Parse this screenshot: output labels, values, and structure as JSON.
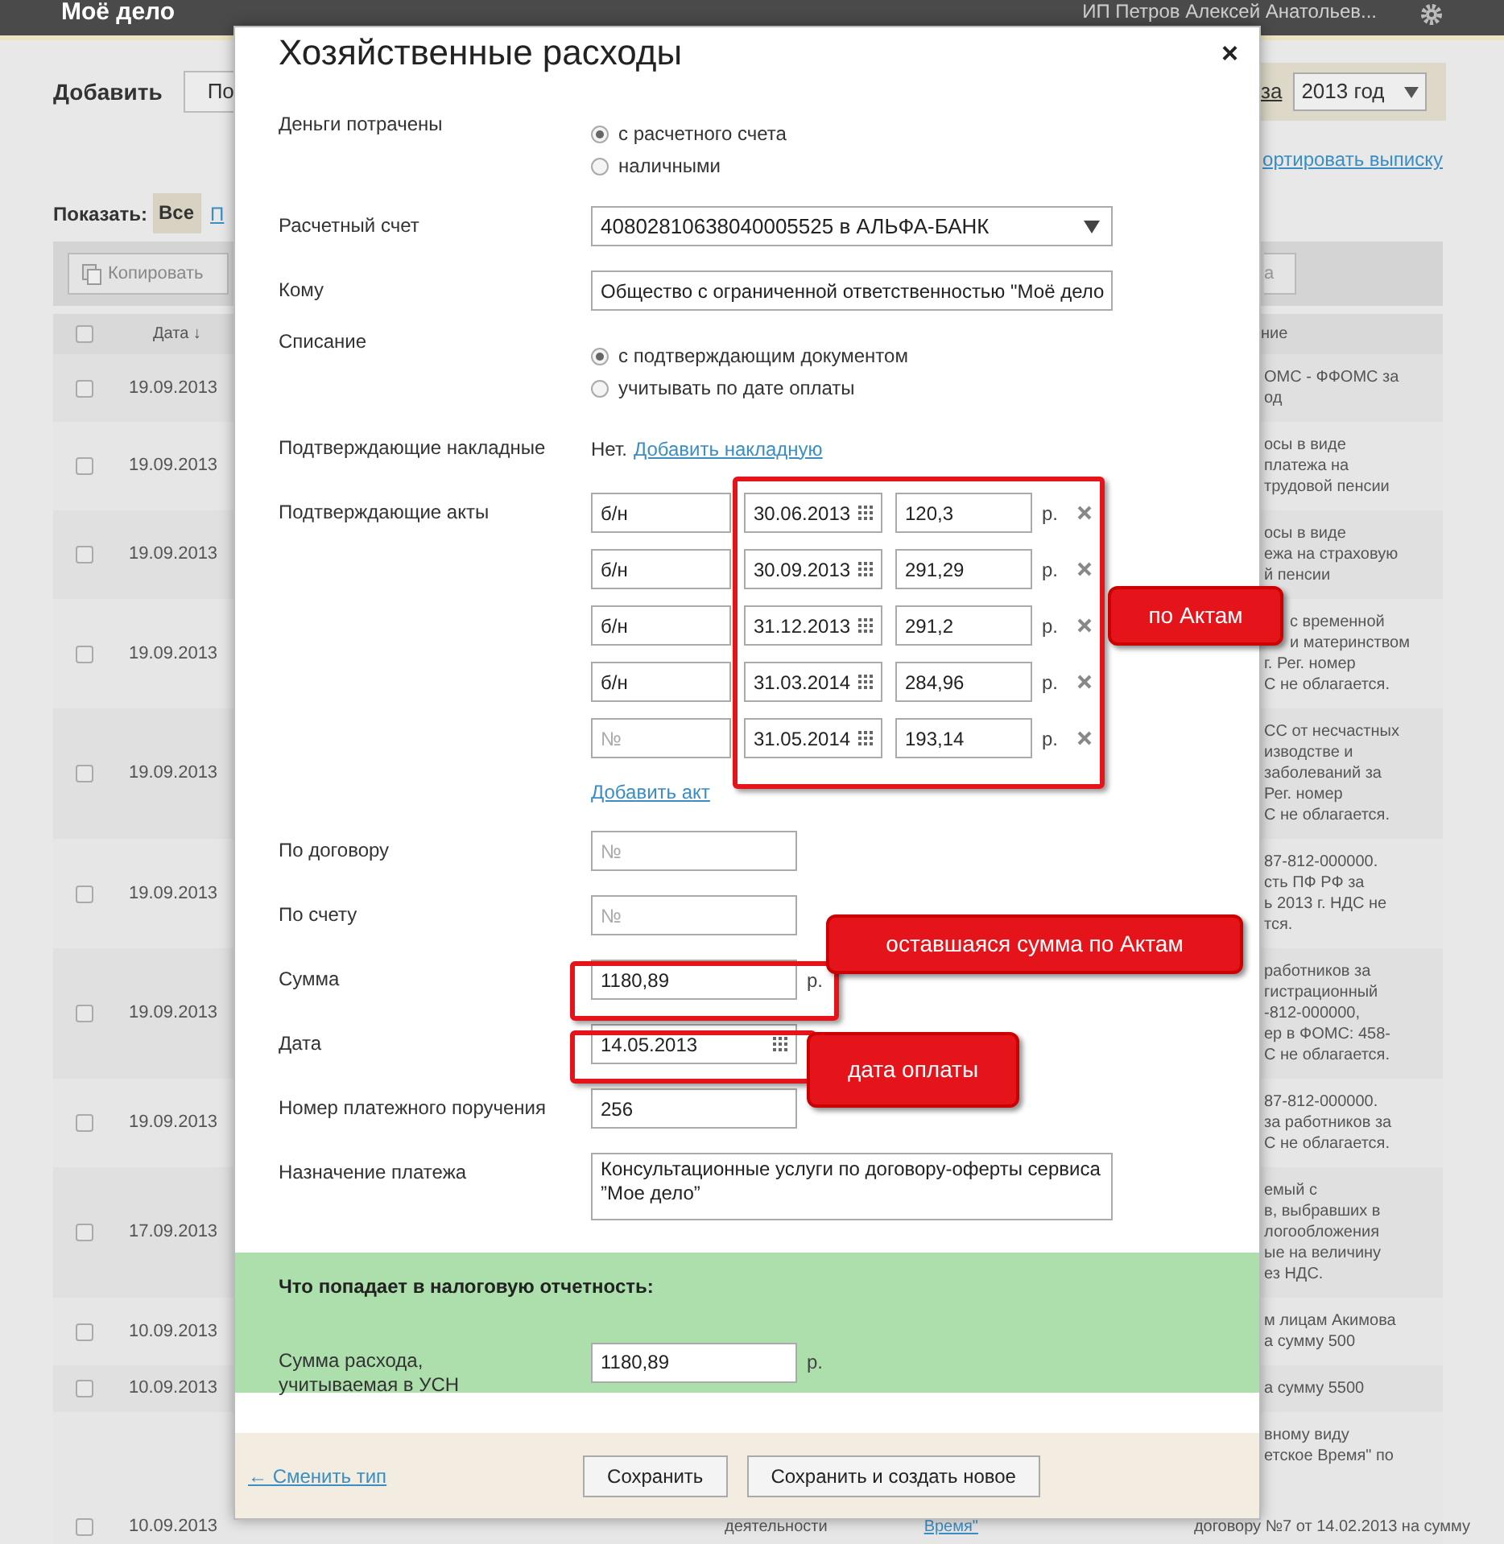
{
  "app": {
    "logo": "Моё дело",
    "user": "ИП Петров Алексей Анатольев..."
  },
  "page": {
    "add_label": "Добавить",
    "add_button": "По",
    "period_link": "за",
    "year_select": "2013 год",
    "import_link": "ортировать выписку",
    "show_label": "Показать:",
    "filters": [
      {
        "label": "Все",
        "selected": true
      },
      {
        "label": "П",
        "selected": false
      }
    ],
    "toolbar": {
      "copy_button": "Копировать",
      "right_button": "а"
    },
    "table": {
      "select_all": {
        "checked": false
      },
      "columns": [
        {
          "label": "Дата ↓"
        },
        {
          "label": "ние"
        }
      ],
      "rows": [
        {
          "checked": false,
          "date": "19.09.2013",
          "description": [
            "ОМС - ФФОМС за",
            "од"
          ]
        },
        {
          "checked": false,
          "date": "19.09.2013",
          "description": [
            "осы в виде",
            "платежа на",
            "трудовой пенсии"
          ]
        },
        {
          "checked": false,
          "date": "19.09.2013",
          "description": [
            "осы в виде",
            "ежа на страховую",
            "й пенсии"
          ]
        },
        {
          "checked": false,
          "date": "19.09.2013",
          "description": [
            "с временной",
            "и материнством",
            "г. Рег. номер",
            "С не облагается."
          ]
        },
        {
          "checked": false,
          "date": "19.09.2013",
          "description": [
            "СС от несчастных",
            "изводстве и",
            "заболеваний за",
            "Рег. номер",
            "С не облагается."
          ]
        },
        {
          "checked": false,
          "date": "19.09.2013",
          "description": [
            "87-812-000000.",
            "сть ПФ РФ за",
            "ь 2013 г. НДС не",
            "тся."
          ]
        },
        {
          "checked": false,
          "date": "19.09.2013",
          "description": [
            "работников за",
            "гистрационный",
            "-812-000000,",
            "ер в ФОМС: 458-",
            "С не облагается."
          ]
        },
        {
          "checked": false,
          "date": "19.09.2013",
          "description": [
            "87-812-000000.",
            "за работников за",
            "С не облагается."
          ]
        },
        {
          "checked": false,
          "date": "17.09.2013",
          "description": [
            "емый с",
            "в, выбравших в",
            "логообложения",
            "ые на величину",
            "ез НДС."
          ]
        },
        {
          "checked": false,
          "date": "10.09.2013",
          "description": [
            "м лицам Акимова",
            "а сумму 500"
          ]
        },
        {
          "checked": false,
          "date": "10.09.2013",
          "description": [
            "а сумму 5500"
          ]
        },
        {
          "checked": false,
          "date": "10.09.2013",
          "description": [
            "вному виду",
            "етское Время\" по"
          ],
          "bottom_line": [
            {
              "text": "деятельности",
              "link": false
            },
            {
              "text": "Время\"",
              "link": true
            },
            {
              "text": "договору №7 от 14.02.2013 на сумму",
              "link": false
            }
          ]
        }
      ]
    }
  },
  "dialog": {
    "title": "Хозяйственные расходы",
    "close": "×",
    "fields": [
      {
        "kind": "radio",
        "label": "Деньги потрачены",
        "options": [
          {
            "label": "с расчетного счета",
            "selected": true
          },
          {
            "label": "наличными",
            "selected": false
          }
        ]
      },
      {
        "kind": "select",
        "label": "Расчетный счет",
        "value": "40802810638040005525 в АЛЬФА-БАНК"
      },
      {
        "kind": "text",
        "label": "Кому",
        "value": "Общество с ограниченной ответственностью \"Моё дело"
      },
      {
        "kind": "radio",
        "label": "Списание",
        "options": [
          {
            "label": "с подтверждающим документом",
            "selected": true
          },
          {
            "label": "учитывать по дате оплаты",
            "selected": false
          }
        ]
      },
      {
        "kind": "note",
        "label": "Подтверждающие накладные",
        "text": "Нет.",
        "link": "Добавить накладную"
      },
      {
        "kind": "acts",
        "label": "Подтверждающие акты",
        "add_link": "Добавить акт",
        "acts": [
          {
            "number": "б/н",
            "date": "30.06.2013",
            "amount": "120,3",
            "currency": "р."
          },
          {
            "number": "б/н",
            "date": "30.09.2013",
            "amount": "291,29",
            "currency": "р."
          },
          {
            "number": "б/н",
            "date": "31.12.2013",
            "amount": "291,2",
            "currency": "р."
          },
          {
            "number": "б/н",
            "date": "31.03.2014",
            "amount": "284,96",
            "currency": "р."
          },
          {
            "number_placeholder": "№",
            "date": "31.05.2014",
            "amount": "193,14",
            "currency": "р."
          }
        ]
      },
      {
        "kind": "short",
        "label": "По договору",
        "placeholder": "№"
      },
      {
        "kind": "short",
        "label": "По счету",
        "placeholder": "№"
      },
      {
        "kind": "short",
        "label": "Сумма",
        "value": "1180,89",
        "currency": "р."
      },
      {
        "kind": "date",
        "label": "Дата",
        "value": "14.05.2013"
      },
      {
        "kind": "short",
        "label": "Номер платежного поручения",
        "value": "256"
      },
      {
        "kind": "textarea",
        "label": "Назначение платежа",
        "value": "Консультационные услуги по договору-оферты сервиса ”Мое дело”"
      }
    ],
    "tax_section": {
      "title": "Что попадает в налоговую отчетность:",
      "label": "Сумма расхода, учитываемая в УСН",
      "value": "1180,89",
      "currency": "р."
    },
    "footer": {
      "back_link": "← Сменить тип",
      "buttons": [
        "Сохранить",
        "Сохранить и создать новое"
      ]
    }
  },
  "annotations": [
    {
      "text": "по Актам"
    },
    {
      "text": "оставшаяся сумма по Актам"
    },
    {
      "text": "дата оплаты"
    }
  ]
}
